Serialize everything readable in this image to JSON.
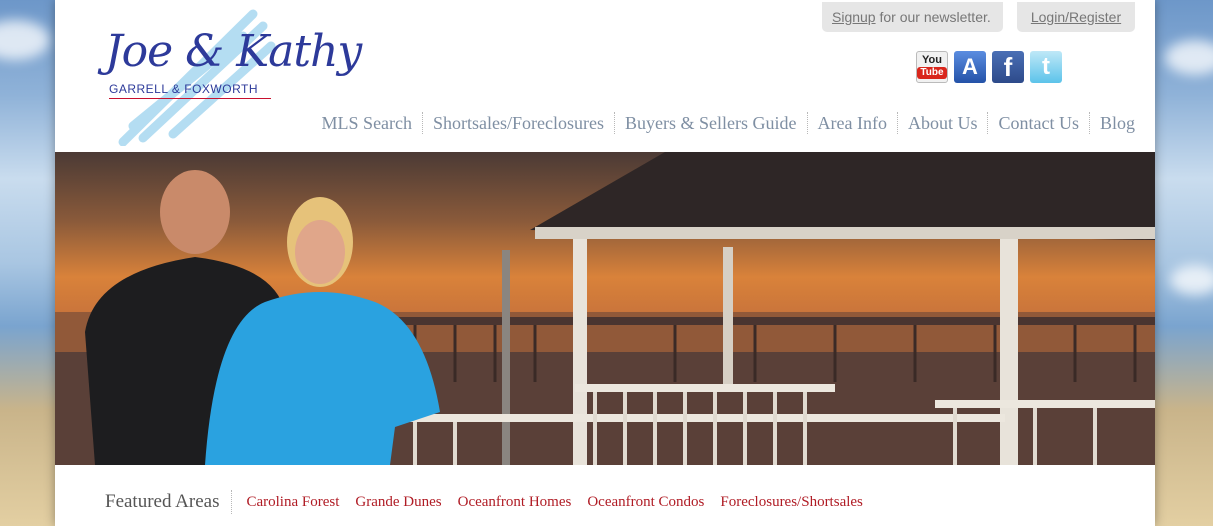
{
  "brand": {
    "logo_script": "Joe & Kathy",
    "logo_sub": "GARRELL & FOXWORTH"
  },
  "utility": {
    "signup_link": "Signup",
    "signup_text": " for our newsletter.",
    "login_label": "Login/Register"
  },
  "social": [
    {
      "name": "youtube",
      "you": "You",
      "tube": "Tube"
    },
    {
      "name": "app-store",
      "glyph": "A"
    },
    {
      "name": "facebook",
      "glyph": "f"
    },
    {
      "name": "twitter",
      "glyph": "t"
    }
  ],
  "nav": {
    "items": [
      "MLS Search",
      "Shortsales/Foreclosures",
      "Buyers & Sellers Guide",
      "Area Info",
      "About Us",
      "Contact Us",
      "Blog"
    ]
  },
  "featured": {
    "title": "Featured Areas",
    "links": [
      "Carolina Forest",
      "Grande Dunes",
      "Oceanfront Homes",
      "Oceanfront Condos",
      "Foreclosures/Shortsales"
    ]
  },
  "colors": {
    "link_red": "#b01c25",
    "nav_gray": "#7f8fa3",
    "logo_blue": "#2d3a9a"
  }
}
